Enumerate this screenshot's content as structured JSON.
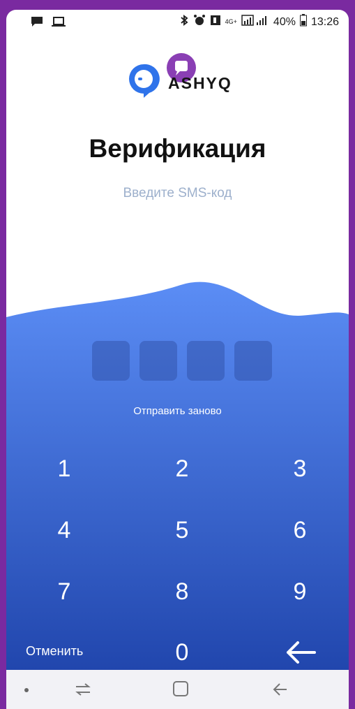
{
  "status_bar": {
    "battery_percent": "40%",
    "time": "13:26",
    "network": "4G+"
  },
  "logo": {
    "text": "ASHYQ"
  },
  "title": "Верификация",
  "subtitle": "Введите SMS-код",
  "code": {
    "digits": [
      "",
      "",
      "",
      ""
    ]
  },
  "resend_label": "Отправить заново",
  "keypad": {
    "keys": [
      "1",
      "2",
      "3",
      "4",
      "5",
      "6",
      "7",
      "8",
      "9",
      "0"
    ],
    "cancel_label": "Отменить"
  },
  "colors": {
    "gradient_top": "#5b8df5",
    "gradient_bottom": "#1b3fa6",
    "frame": "#7a2aa0"
  },
  "icons": {
    "status_left": [
      "chat-icon",
      "laptop-icon"
    ],
    "status_right": [
      "bluetooth-icon",
      "alarm-icon",
      "notification-icon",
      "signal-icon",
      "battery-icon"
    ],
    "backspace": "arrow-left-icon"
  }
}
